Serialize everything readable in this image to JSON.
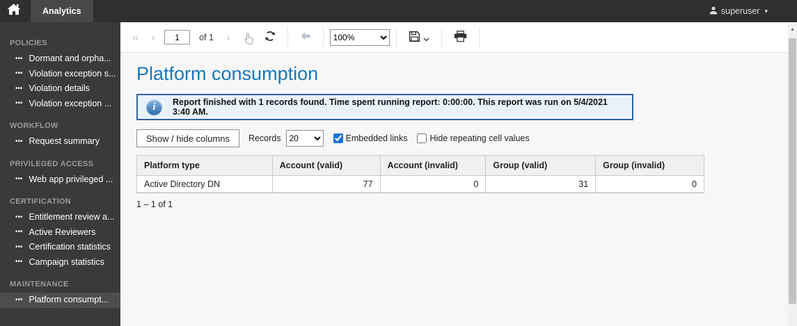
{
  "topbar": {
    "tab_label": "Analytics",
    "user_label": "superuser"
  },
  "sidebar": {
    "item_icon_glyph": "•••",
    "sections": [
      {
        "title": "POLICIES",
        "items": [
          {
            "label": "Dormant and orpha..."
          },
          {
            "label": "Violation exception s..."
          },
          {
            "label": "Violation details"
          },
          {
            "label": "Violation exception ..."
          }
        ]
      },
      {
        "title": "WORKFLOW",
        "items": [
          {
            "label": "Request summary"
          }
        ]
      },
      {
        "title": "PRIVILEGED ACCESS",
        "items": [
          {
            "label": "Web app privileged ..."
          }
        ]
      },
      {
        "title": "CERTIFICATION",
        "items": [
          {
            "label": "Entitlement review a..."
          },
          {
            "label": "Active Reviewers"
          },
          {
            "label": "Certification statistics"
          },
          {
            "label": "Campaign statistics"
          }
        ]
      },
      {
        "title": "MAINTENANCE",
        "items": [
          {
            "label": "Platform consumpt...",
            "selected": true
          }
        ]
      }
    ]
  },
  "toolbar": {
    "first_page_glyph": "«",
    "prev_page_glyph": "‹",
    "next_page_glyph": "›",
    "page_value": "1",
    "of_label": "of 1",
    "zoom_value": "100%"
  },
  "report": {
    "title": "Platform consumption",
    "info_icon_glyph": "i",
    "info_message": "Report finished with 1 records found. Time spent running report: 0:00:00. This report was run on 5/4/2021 3:40 AM.",
    "controls": {
      "show_hide_button": "Show / hide columns",
      "records_label": "Records",
      "records_value": "20",
      "embedded_links_label": "Embedded links",
      "embedded_links_checked": true,
      "hide_repeating_label": "Hide repeating cell values",
      "hide_repeating_checked": false
    },
    "table": {
      "columns": [
        "Platform type",
        "Account (valid)",
        "Account (invalid)",
        "Group (valid)",
        "Group (invalid)"
      ],
      "rows": [
        [
          "Active Directory DN",
          "77",
          "0",
          "31",
          "0"
        ]
      ],
      "footer": "1 – 1 of 1"
    }
  },
  "icons": {
    "home": "white-house",
    "user": "person-silhouette",
    "user_caret_glyph": "▾",
    "refresh": "circular-arrows",
    "back": "gray-left-arrow",
    "save": "floppy-disk",
    "save_caret": "chevron-down",
    "print": "printer",
    "hand_cursor": "pointing-hand",
    "scroll_up_glyph": "▴"
  },
  "colors": {
    "title_blue": "#1878bd",
    "banner_border": "#31639a",
    "banner_bg": "#e9f2fa",
    "checkbox_accent": "#1b74d9",
    "topbar_bg": "#2f2f2f",
    "sidebar_bg": "#3a3a3a",
    "sidebar_selected_bg": "#4d4d4d"
  }
}
